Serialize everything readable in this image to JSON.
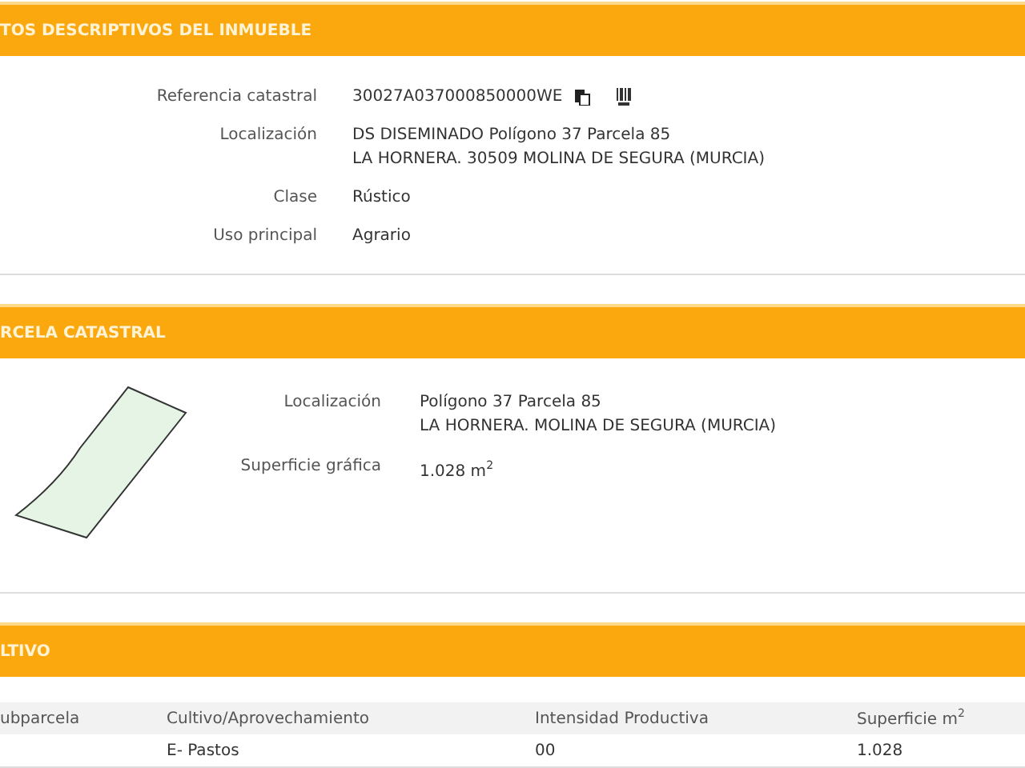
{
  "sections": [
    {
      "title": "TOS DESCRIPTIVOS DEL INMUEBLE",
      "kind": "fields",
      "fields": [
        {
          "label": "Referencia catastral",
          "lines": [
            "30027A037000850000WE"
          ],
          "icons": true
        },
        {
          "label": "Localización",
          "lines": [
            "DS DISEMINADO Polígono 37 Parcela 85",
            "LA HORNERA. 30509 MOLINA DE SEGURA (MURCIA)"
          ]
        },
        {
          "label": "Clase",
          "lines": [
            "Rústico"
          ]
        },
        {
          "label": "Uso principal",
          "lines": [
            "Agrario"
          ]
        }
      ]
    },
    {
      "title": "RCELA CATASTRAL",
      "kind": "parcel",
      "fields": [
        {
          "label": "Localización",
          "lines": [
            "Polígono 37 Parcela 85",
            "LA HORNERA. MOLINA DE SEGURA (MURCIA)"
          ]
        },
        {
          "label": "Superficie gráfica",
          "lines": [
            "1.028 m$^{2}$"
          ]
        }
      ]
    },
    {
      "title": "LTIVO",
      "kind": "table",
      "columns": [
        "ubparcela",
        "Cultivo/Aprovechamiento",
        "Intensidad Productiva",
        "Superficie m$^{2}$"
      ],
      "rows": [
        [
          "",
          "E- Pastos",
          "00",
          "1.028"
        ]
      ]
    }
  ]
}
